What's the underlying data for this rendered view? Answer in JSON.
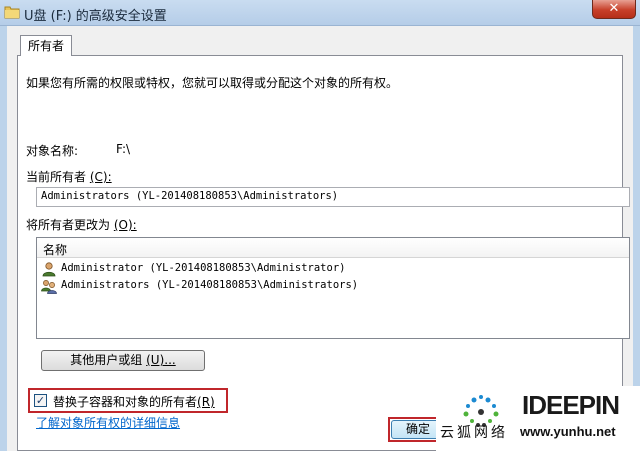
{
  "window": {
    "title": "U盘 (F:) 的高级安全设置",
    "close_label": "✕"
  },
  "tab": {
    "label": "所有者"
  },
  "main": {
    "intro": "如果您有所需的权限或特权，您就可以取得或分配这个对象的所有权。",
    "object_name_label": "对象名称:",
    "object_name_value": "F:\\",
    "current_owner_label": "当前所有者",
    "current_owner_key": "(C):",
    "current_owner_value": "Administrators (YL-201408180853\\Administrators)",
    "change_owner_label": "将所有者更改为",
    "change_owner_key": "(O):",
    "list_header": "名称",
    "list_items": [
      {
        "icon": "user-icon",
        "label": "Administrator (YL-201408180853\\Administrator)"
      },
      {
        "icon": "user-group-icon",
        "label": "Administrators (YL-201408180853\\Administrators)"
      }
    ],
    "other_users_button": "其他用户或组",
    "other_users_key": "(U)...",
    "replace_owner_label": "替换子容器和对象的所有者",
    "replace_owner_key": "(R)",
    "replace_owner_checked": true,
    "learn_more_link": "了解对象所有权的详细信息",
    "ok_button": "确定"
  },
  "watermark": {
    "brand": "IDEEPIN",
    "cn_text": "云狐网络",
    "url": "www.yunhu.net"
  }
}
